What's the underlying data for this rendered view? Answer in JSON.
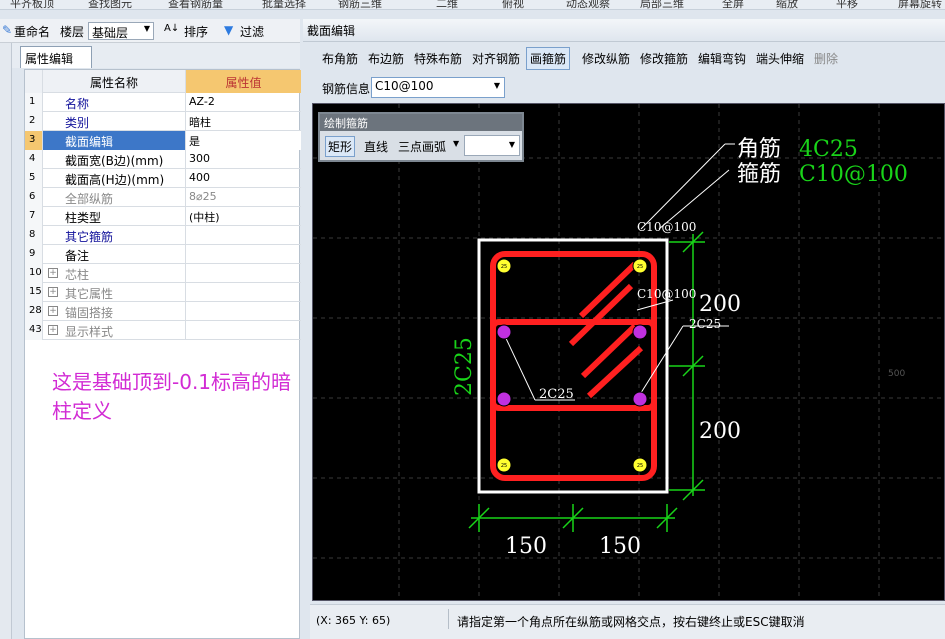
{
  "top_toolbar": {
    "items": [
      "平齐板顶",
      "查找图元",
      "查看钢筋量",
      "批量选择",
      "钢筋三维",
      "二维",
      "俯视",
      "动态观察",
      "局部三维",
      "全屏",
      "缩放",
      "平移",
      "屏幕旋转"
    ]
  },
  "left_toolbar": {
    "rename": "重命名",
    "floor_label": "楼层",
    "floor_value": "基础层",
    "sort": "排序",
    "filter": "过滤"
  },
  "prop_panel": {
    "tab": "属性编辑",
    "col_name": "属性名称",
    "col_value": "属性值",
    "rows": [
      {
        "n": "1",
        "name": "名称",
        "value": "AZ-2"
      },
      {
        "n": "2",
        "name": "类别",
        "value": "暗柱"
      },
      {
        "n": "3",
        "name": "截面编辑",
        "value": "是"
      },
      {
        "n": "4",
        "name": "截面宽(B边)(mm)",
        "value": "300"
      },
      {
        "n": "5",
        "name": "截面高(H边)(mm)",
        "value": "400"
      },
      {
        "n": "6",
        "name": "全部纵筋",
        "value": "8⌀25"
      },
      {
        "n": "7",
        "name": "柱类型",
        "value": "(中柱)"
      },
      {
        "n": "8",
        "name": "其它箍筋",
        "value": ""
      },
      {
        "n": "9",
        "name": "备注",
        "value": ""
      },
      {
        "n": "10",
        "name": "芯柱",
        "value": ""
      },
      {
        "n": "15",
        "name": "其它属性",
        "value": ""
      },
      {
        "n": "28",
        "name": "锚固搭接",
        "value": ""
      },
      {
        "n": "43",
        "name": "显示样式",
        "value": ""
      }
    ]
  },
  "annotation_note": "这是基础顶到-0.1标高的暗柱定义",
  "section_editor": {
    "title": "截面编辑",
    "toolbar": [
      "布角筋",
      "布边筋",
      "特殊布筋",
      "对齐钢筋",
      "画箍筋",
      "修改纵筋",
      "修改箍筋",
      "编辑弯钩",
      "端头伸缩",
      "删除"
    ],
    "rebar_info_label": "钢筋信息",
    "rebar_info_value": "C10@100",
    "draw_panel": {
      "title": "绘制箍筋",
      "rect": "矩形",
      "line": "直线",
      "arc": "三点画弧"
    },
    "canvas": {
      "corner_label": "角筋",
      "corner_value": "4C25",
      "stirrup_label": "箍筋",
      "stirrup_value": "C10@100",
      "stirrup_tag_1": "C10@100",
      "stirrup_tag_2": "C10@100",
      "side_left": "2C25",
      "side_inner_right": "2C25",
      "side_inner_bottom": "2C25",
      "dim_right_top": "200",
      "dim_right_bottom": "200",
      "dim_bottom_left": "150",
      "dim_bottom_right": "150",
      "grid_tick": "500",
      "bar_tag": "25"
    }
  },
  "status_bar": {
    "coords": "(X: 365 Y: 65)",
    "message": "请指定第一个角点所在纵筋或网格交点，按右键终止或ESC键取消"
  },
  "colors": {
    "accent": "#f5c770",
    "canvas_bg": "#000000",
    "rebar_red": "#ff2020",
    "dim_green": "#19d419",
    "note_magenta": "#d22bd4"
  }
}
